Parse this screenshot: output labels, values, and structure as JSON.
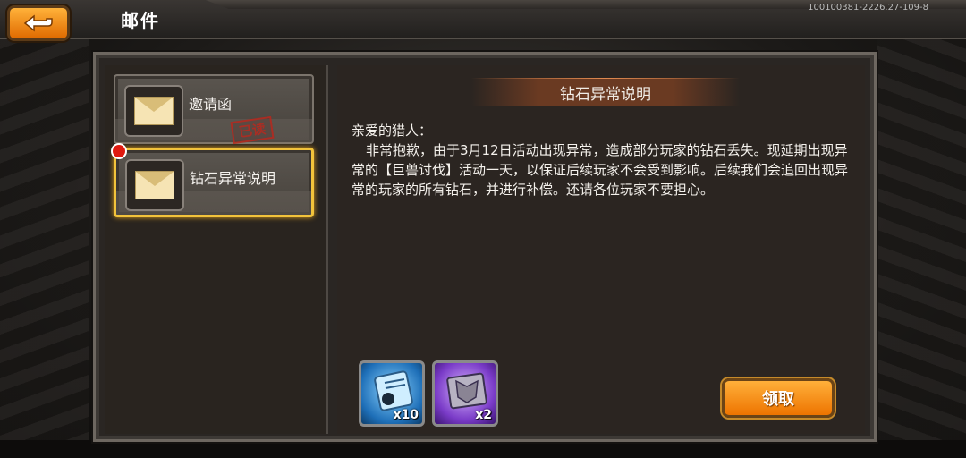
{
  "header": {
    "title": "邮件",
    "version": "100100381-2226.27-109-8",
    "back_label": ""
  },
  "mail_list": [
    {
      "label": "邀请函",
      "status": "已读",
      "selected": false,
      "unread": false
    },
    {
      "label": "钻石异常说明",
      "status": "",
      "selected": true,
      "unread": true
    }
  ],
  "message": {
    "title": "钻石异常说明",
    "greeting": "亲爱的猎人：",
    "body": "非常抱歉，由于3月12日活动出现异常，造成部分玩家的钻石丢失。现延期出现异常的【巨兽讨伐】活动一天，以保证后续玩家不会受到影响。后续我们会追回出现异常的玩家的所有钻石，并进行补偿。还请各位玩家不要担心。",
    "attachments": [
      {
        "icon": "blue-scroll-item-icon",
        "quantity": "x10"
      },
      {
        "icon": "purple-armor-item-icon",
        "quantity": "x2"
      }
    ],
    "claim_label": "领取"
  },
  "colors": {
    "accent_orange": "#ee7400",
    "selection_gold": "#f2c33b",
    "unread_red": "#e01a10"
  }
}
